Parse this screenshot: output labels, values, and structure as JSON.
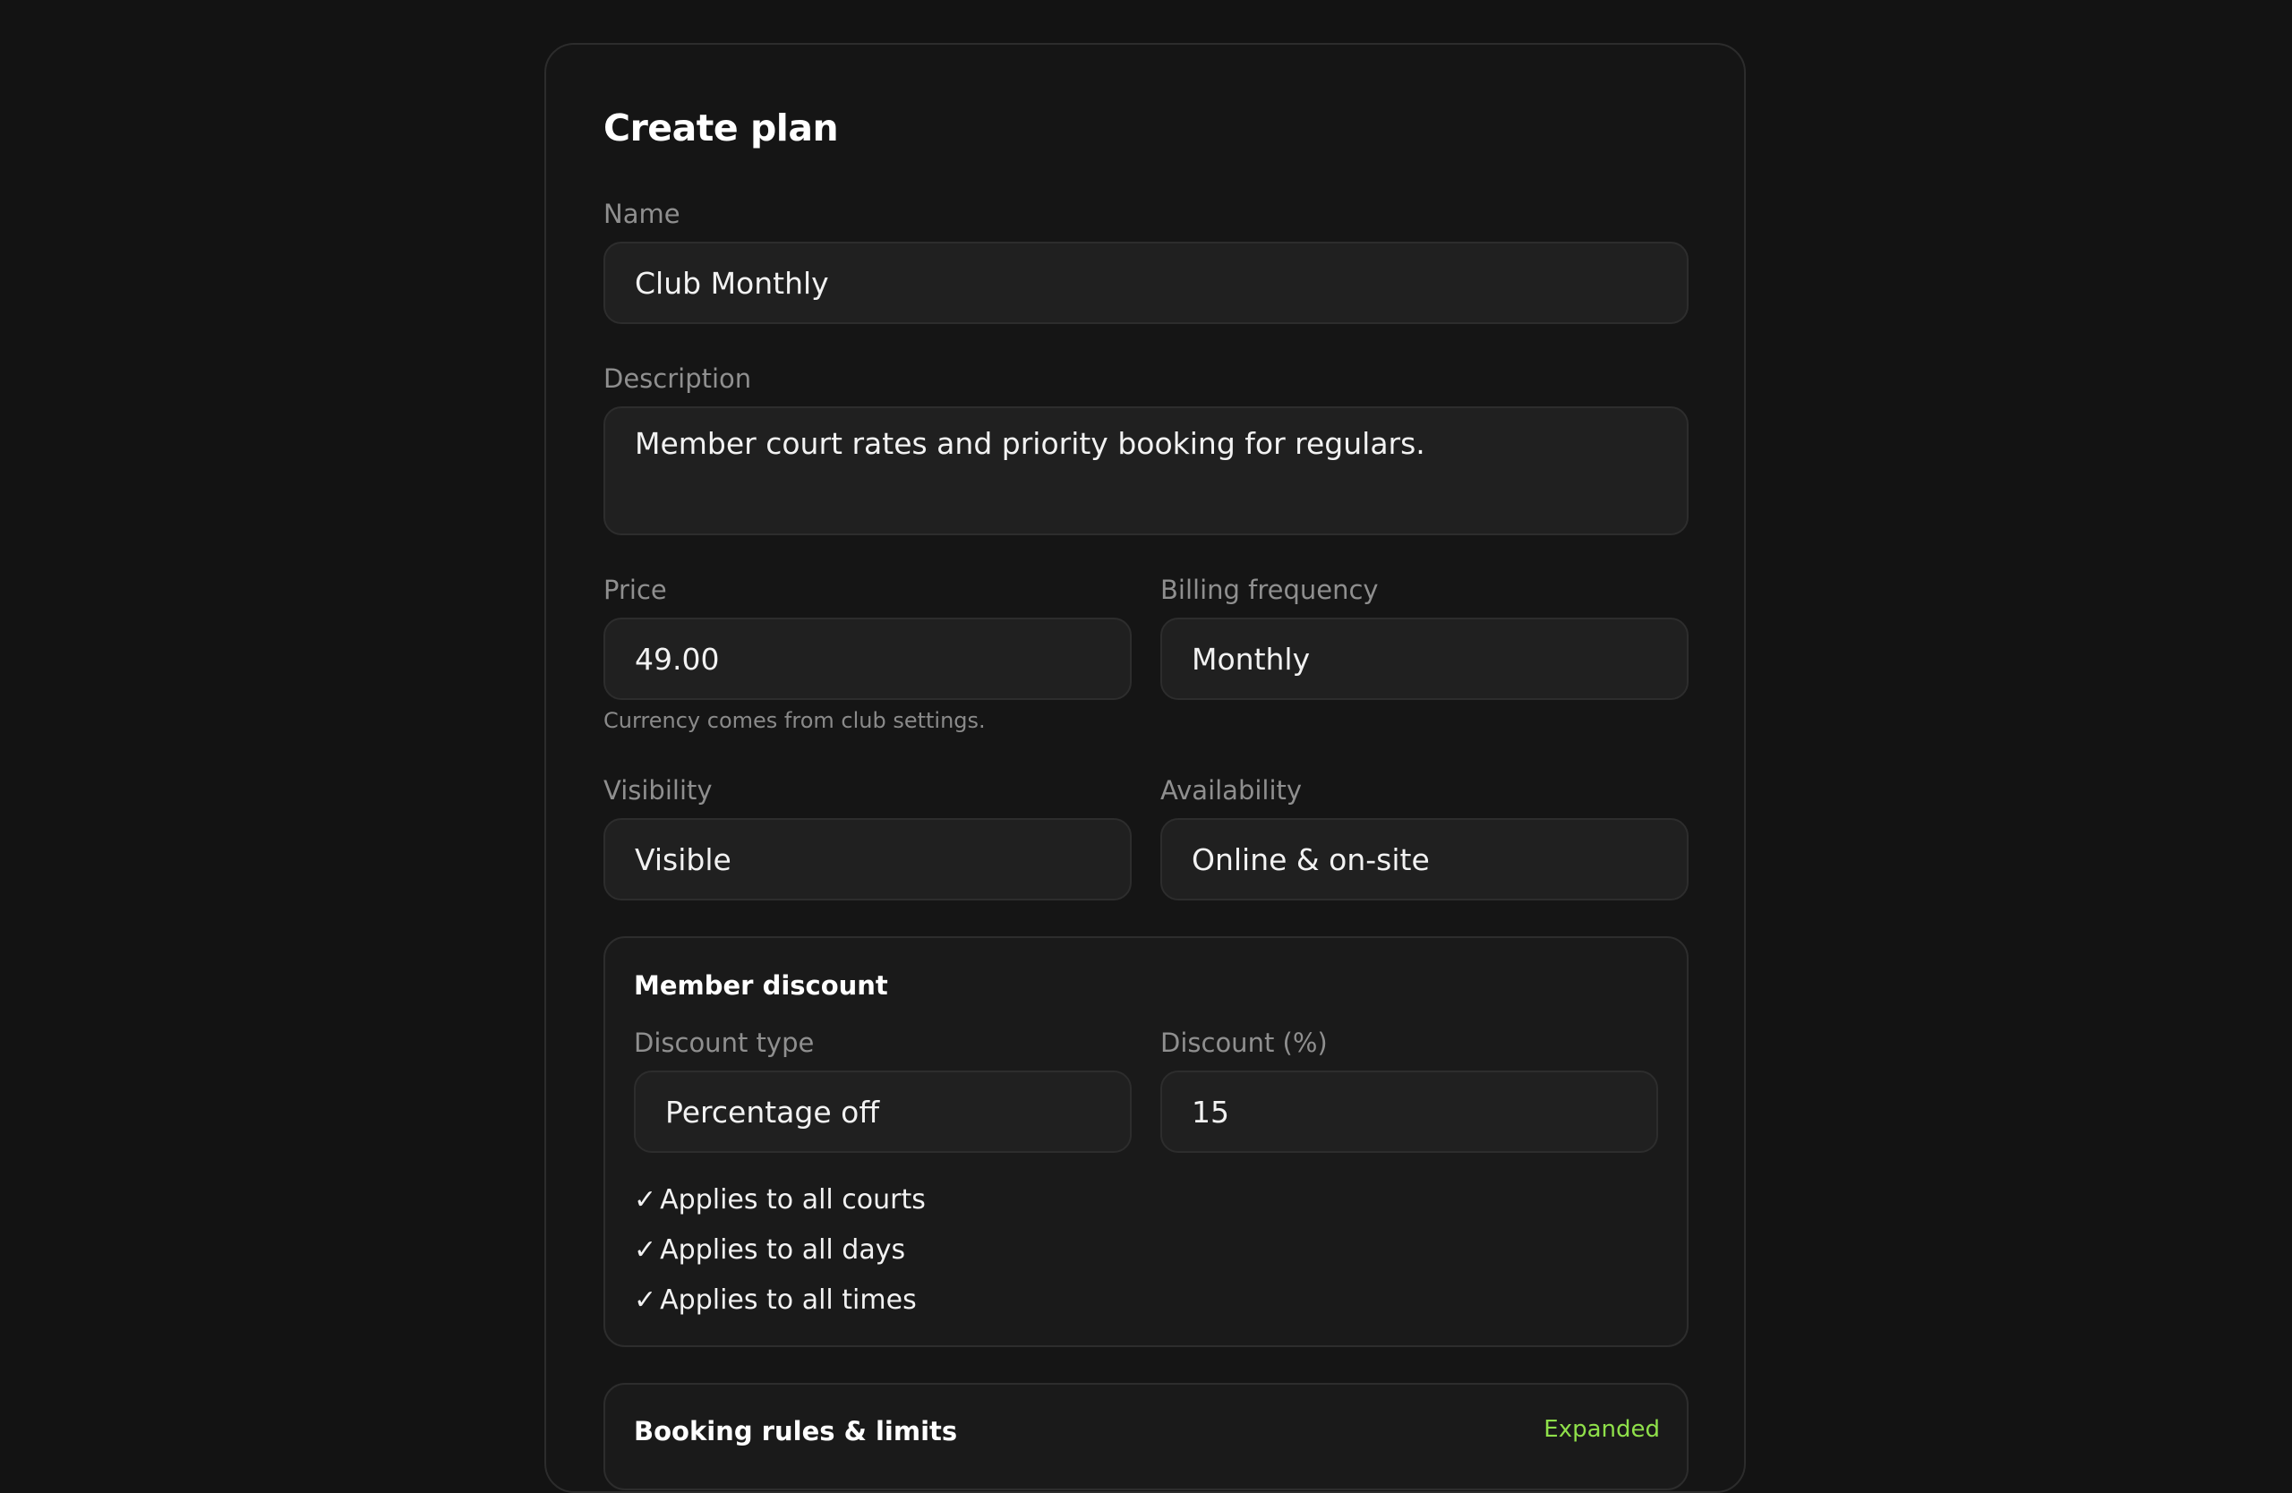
{
  "form": {
    "title": "Create plan",
    "name": {
      "label": "Name",
      "value": "Club Monthly"
    },
    "description": {
      "label": "Description",
      "value": "Member court rates and priority booking for regulars."
    },
    "price": {
      "label": "Price",
      "value": "49.00",
      "hint": "Currency comes from club settings."
    },
    "billing_frequency": {
      "label": "Billing frequency",
      "value": "Monthly"
    },
    "visibility": {
      "label": "Visibility",
      "value": "Visible"
    },
    "availability": {
      "label": "Availability",
      "value": "Online & on-site"
    }
  },
  "member_discount": {
    "title": "Member discount",
    "discount_type": {
      "label": "Discount type",
      "value": "Percentage off"
    },
    "discount_percent": {
      "label": "Discount (%)",
      "value": "15"
    },
    "check_mark": "✓",
    "applies": [
      "Applies to all courts",
      "Applies to all days",
      "Applies to all times"
    ]
  },
  "booking_rules": {
    "title": "Booking rules & limits",
    "status": "Expanded"
  },
  "colors": {
    "background": "#131313",
    "field": "#202020",
    "accent_green": "#8fe04a"
  }
}
